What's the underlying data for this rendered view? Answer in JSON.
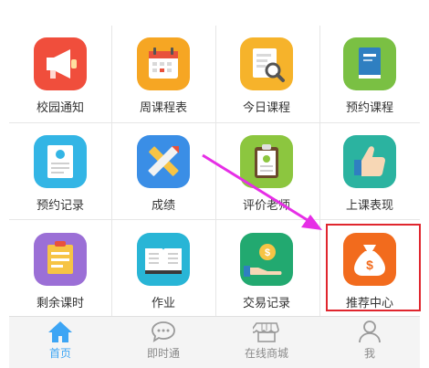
{
  "grid": {
    "items": [
      {
        "label": "校园通知",
        "icon": "megaphone-icon",
        "color": "#f04e3c"
      },
      {
        "label": "周课程表",
        "icon": "calendar-icon",
        "color": "#f6a623"
      },
      {
        "label": "今日课程",
        "icon": "document-search-icon",
        "color": "#f6b32b"
      },
      {
        "label": "预约课程",
        "icon": "book-icon",
        "color": "#7ac043"
      },
      {
        "label": "预约记录",
        "icon": "record-icon",
        "color": "#33b5e5"
      },
      {
        "label": "成绩",
        "icon": "ruler-pencil-icon",
        "color": "#3a8ee6"
      },
      {
        "label": "评价老师",
        "icon": "clipboard-icon",
        "color": "#8cc63f"
      },
      {
        "label": "上课表现",
        "icon": "thumbs-up-icon",
        "color": "#2bb3a0"
      },
      {
        "label": "剩余课时",
        "icon": "notepad-icon",
        "color": "#9b6fd6"
      },
      {
        "label": "作业",
        "icon": "open-book-icon",
        "color": "#28b5d6"
      },
      {
        "label": "交易记录",
        "icon": "coin-hand-icon",
        "color": "#22a970"
      },
      {
        "label": "推荐中心",
        "icon": "money-bag-icon",
        "color": "#f26b1d"
      }
    ]
  },
  "tabbar": {
    "items": [
      {
        "label": "首页",
        "icon": "home-icon",
        "active": true
      },
      {
        "label": "即时通",
        "icon": "chat-icon",
        "active": false
      },
      {
        "label": "在线商城",
        "icon": "store-icon",
        "active": false
      },
      {
        "label": "我",
        "icon": "user-icon",
        "active": false
      }
    ]
  },
  "colors": {
    "accent": "#3da5f4",
    "highlight_border": "#e0262e",
    "arrow": "#e62ee6"
  }
}
